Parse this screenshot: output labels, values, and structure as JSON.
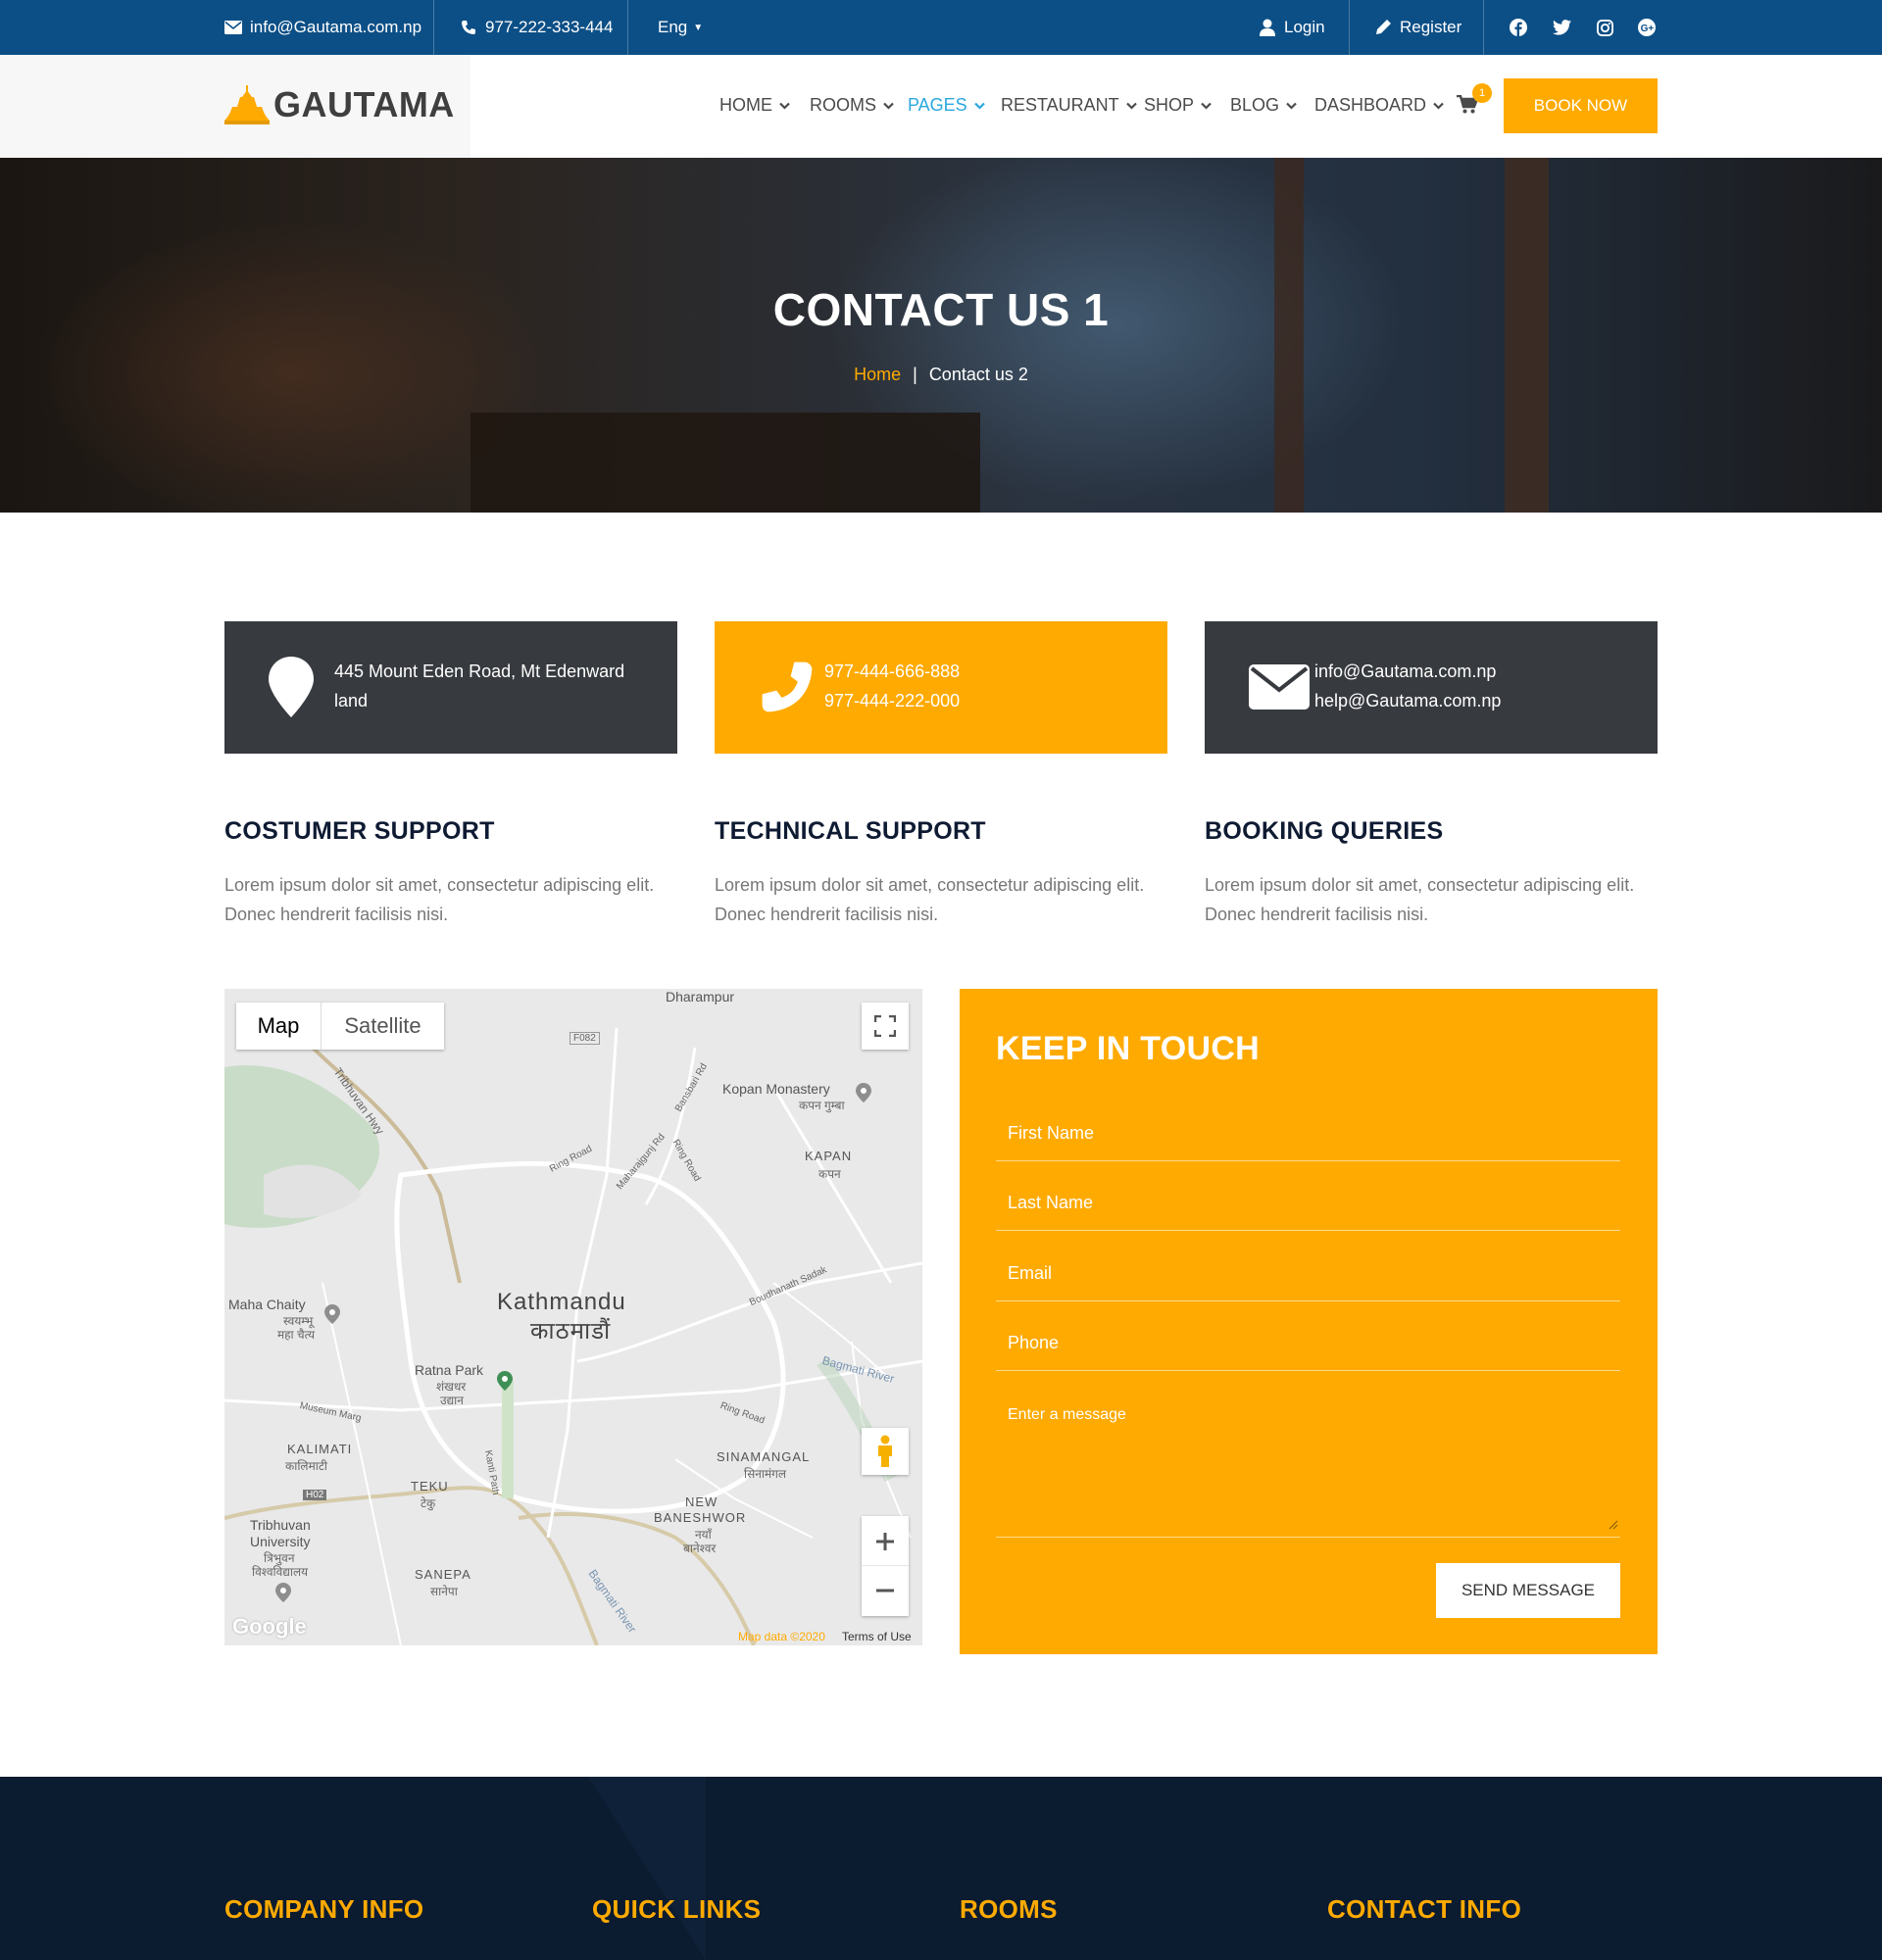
{
  "topbar": {
    "email": "info@Gautama.com.np",
    "phone": "977-222-333-444",
    "language": "Eng",
    "login": "Login",
    "register": "Register",
    "social_icons": [
      "facebook-icon",
      "twitter-icon",
      "instagram-icon",
      "google-plus-icon"
    ]
  },
  "header": {
    "logo": "GAUTAMA",
    "nav": {
      "home": "HOME",
      "rooms": "ROOMS",
      "pages": "PAGES",
      "restaurant": "RESTAURANT",
      "shop": "SHOP",
      "blog": "BLOG",
      "dashboard": "DASHBOARD"
    },
    "cart_count": "1",
    "book_now": "BOOK NOW"
  },
  "hero": {
    "title": "CONTACT US 1",
    "breadcrumb_home": "Home",
    "breadcrumb_sep": "|",
    "breadcrumb_current": "Contact us 2"
  },
  "info": {
    "address_line1": "445 Mount Eden Road, Mt Edenward",
    "address_line2": "land",
    "phone1": "977-444-666-888",
    "phone2": "977-444-222-000",
    "email1": "info@Gautama.com.np",
    "email2": "help@Gautama.com.np"
  },
  "support": [
    {
      "title": "COSTUMER SUPPORT",
      "text": "Lorem ipsum dolor sit amet, consectetur adipiscing elit. Donec hendrerit facilisis nisi."
    },
    {
      "title": "TECHNICAL SUPPORT",
      "text": "Lorem ipsum dolor sit amet, consectetur adipiscing elit. Donec hendrerit facilisis nisi."
    },
    {
      "title": "BOOKING QUERIES",
      "text": "Lorem ipsum dolor sit amet, consectetur adipiscing elit. Donec hendrerit facilisis nisi."
    }
  ],
  "map": {
    "tab_map": "Map",
    "tab_satellite": "Satellite",
    "labels": {
      "dharampur": "Dharampur",
      "f082": "F082",
      "kopan_monastery": "Kopan Monastery",
      "kopan_monastery_np": "कपन गुम्बा",
      "kapan": "KAPAN",
      "kapan_np": "कपन",
      "tribhuvan_hwy": "Tribhuvan Hwy",
      "ring_road_1": "Ring Road",
      "maharajgunj_rd": "Maharajgunj Rd",
      "bansbari_rd": "Bansbari Rd",
      "ring_road_2": "Ring Road",
      "maha_chaity": "Maha Chaity",
      "maha_chaity_np1": "स्वयम्भू",
      "maha_chaity_np2": "महा चैत्य",
      "kathmandu": "Kathmandu",
      "kathmandu_np": "काठमाडौं",
      "boudhanath_sadak": "Boudhanath Sadak",
      "bagmati_river_1": "Bagmati River",
      "ratna_park": "Ratna Park",
      "ratna_park_np1": "शंखधर",
      "ratna_park_np2": "उद्यान",
      "museum_marg": "Museum Marg",
      "ring_road_3": "Ring Road",
      "kalimati": "KALIMATI",
      "kalimati_np": "कालिमाटी",
      "kanti_path": "Kanti Path",
      "sinamangal": "SINAMANGAL",
      "sinamangal_np": "सिनामंगल",
      "h02": "H02",
      "teku": "TEKU",
      "teku_np": "टेकु",
      "new_baneshwor_1": "NEW",
      "new_baneshwor_2": "BANESHWOR",
      "new_baneshwor_np1": "नयाँ",
      "new_baneshwor_np2": "बानेश्वर",
      "tribhuvan_univ_1": "Tribhuvan",
      "tribhuvan_univ_2": "University",
      "tribhuvan_univ_np1": "त्रिभुवन",
      "tribhuvan_univ_np2": "विश्वविद्यालय",
      "sanepa": "SANEPA",
      "sanepa_np": "सानेपा",
      "bagmati_river_2": "Bagmati River"
    },
    "google": "Google",
    "map_data": "Map data ©2020",
    "terms": "Terms of Use"
  },
  "form": {
    "title": "KEEP IN TOUCH",
    "first_name": "First Name",
    "last_name": "Last Name",
    "email": "Email",
    "phone": "Phone",
    "message": "Enter a message",
    "send": "SEND MESSAGE"
  },
  "footer": {
    "company_info": "COMPANY INFO",
    "quick_links": "QUICK LINKS",
    "rooms": "ROOMS",
    "contact_info": "CONTACT INFO"
  },
  "colors": {
    "topbar": "#0c4f86",
    "accent": "#ffaa00",
    "dark_box": "#373a3f",
    "nav_active": "#2aa7df",
    "footer": "#0b1b30"
  }
}
